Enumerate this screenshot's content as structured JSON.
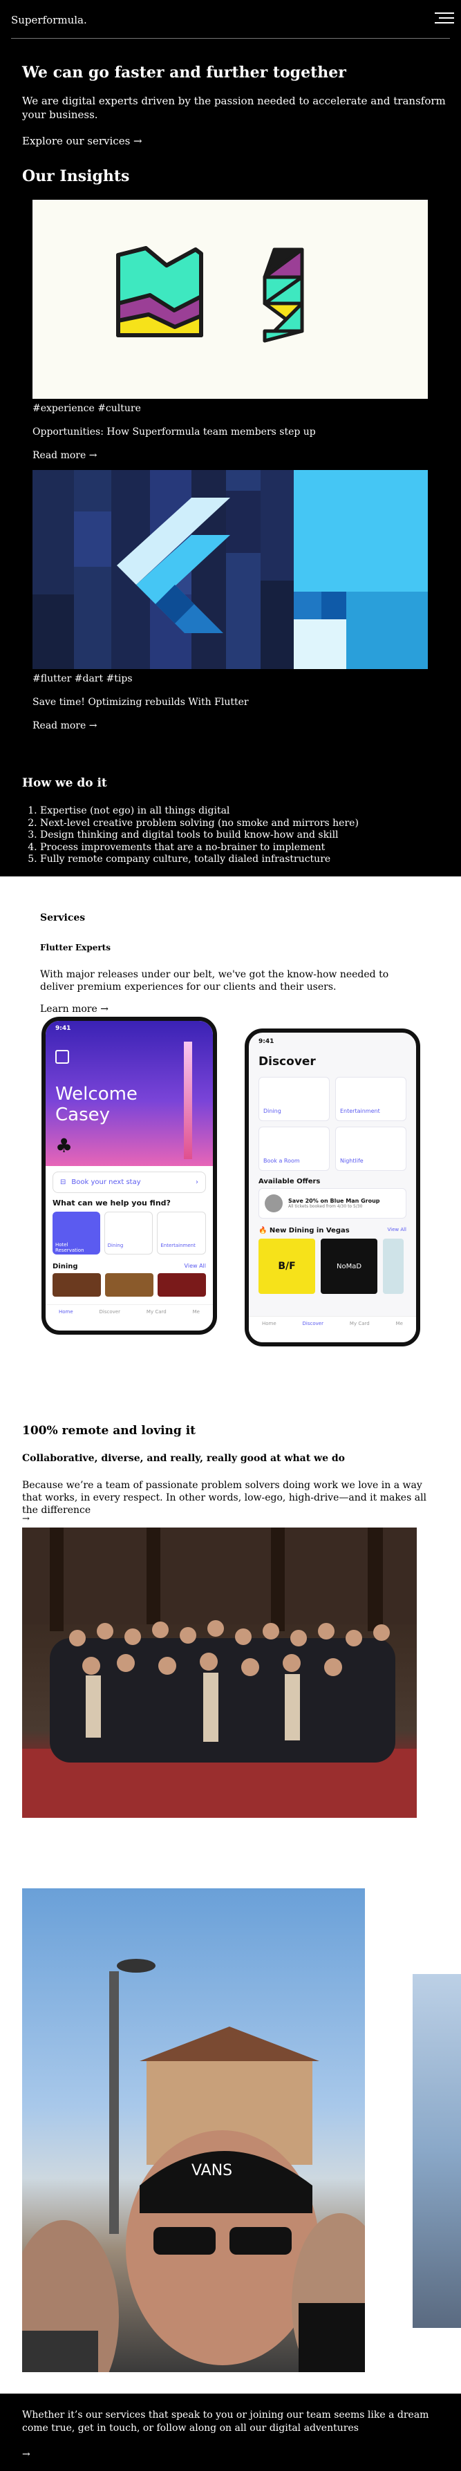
{
  "header": {
    "logo": "Superformula."
  },
  "hero": {
    "title": "We can go faster and further together",
    "body": "We are digital experts driven by the passion needed to accelerate and transform your business.",
    "link": "Explore our services →"
  },
  "insights": {
    "title": "Our Insights",
    "items": [
      {
        "tags": "#experience #culture",
        "title": "Opportunities: How Superformula team members step up",
        "more": "Read more →"
      },
      {
        "tags": "#flutter #dart #tips",
        "title": "Save time! Optimizing rebuilds With Flutter",
        "more": "Read more →"
      }
    ]
  },
  "how": {
    "title": "How we do it",
    "items": [
      "Expertise (not ego) in all things digital",
      "Next-level creative problem solving (no smoke and mirrors here)",
      "Design thinking and digital tools to build know-how and skill",
      "Process improvements that are a no-brainer to implement",
      "Fully remote company culture, totally dialed infrastructure"
    ]
  },
  "services": {
    "title": "Services",
    "subtitle": "Flutter Experts",
    "body": "With major releases under our belt, we've got the know-how needed to deliver premium experiences for our clients and their users.",
    "link": "Learn more →",
    "phone1": {
      "time": "9:41",
      "welcome": "Welcome",
      "name": "Casey",
      "book": "Book your next stay",
      "help": "What can we help you find?",
      "cats": [
        "Hotel Reservation",
        "Dining",
        "Entertainment"
      ],
      "dining": "Dining",
      "view_all": "View All",
      "nav": [
        "Home",
        "Discover",
        "My Card",
        "Me"
      ]
    },
    "phone2": {
      "time": "9:41",
      "title": "Discover",
      "tiles": [
        "Dining",
        "Entertainment",
        "Book a Room",
        "Nightlife"
      ],
      "offers_title": "Available Offers",
      "offer": "Save 20% on Blue Man Group",
      "offer_sub": "All tickets booked from 4/30 to 5/30",
      "new_dining": "🔥 New Dining in Vegas",
      "view_all": "View All",
      "restaurants": [
        "B/F",
        "NoMaD"
      ],
      "nav": [
        "Home",
        "Discover",
        "My Card",
        "Me"
      ]
    }
  },
  "remote": {
    "title": "100% remote and loving it",
    "subtitle": "Collaborative, diverse, and really, really good at what we do",
    "body": "Because we’re a team of passionate problem solvers doing work we love in a way that works, in every respect. In other words, low-ego, high-drive—and it makes all the difference",
    "arrow": "→"
  },
  "footer": {
    "text": "Whether it’s our services that speak to you or joining our team seems like a dream come true, get in touch, or follow along on all our digital adventures",
    "arrow": "→"
  },
  "colors": {
    "bg": "#000000",
    "accent": "#5b5bf0",
    "mint": "#3ee8c0",
    "yellow": "#f6e21a",
    "purple": "#9b3f96",
    "flutter_sky": "#45c6f4",
    "navy": "#1a2448"
  },
  "icons": [
    "hamburger-menu-icon",
    "arrow-right-icon",
    "hotel-icon",
    "dining-icon",
    "entertainment-icon",
    "nightlife-icon",
    "home-icon",
    "discover-icon",
    "card-icon",
    "me-icon"
  ]
}
